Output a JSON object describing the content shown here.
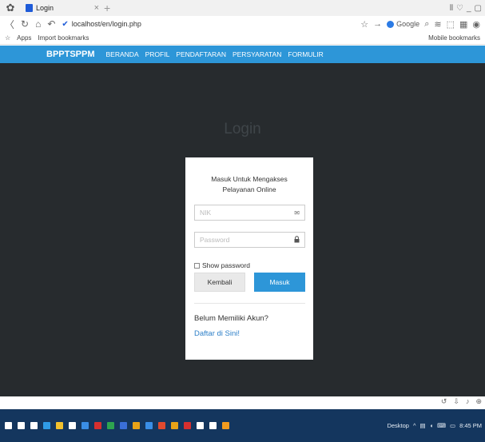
{
  "browser": {
    "tab_title": "Login",
    "tab_close": "×",
    "new_tab": "+",
    "window_controls": [
      "⫴",
      "♡",
      "_",
      "▢"
    ],
    "url": "localhost/en/login.php",
    "search_engine": "Google",
    "bookmarks": {
      "apps": "Apps",
      "import": "Import bookmarks",
      "mobile": "Mobile bookmarks"
    }
  },
  "site": {
    "brand": "BPPTSPPM",
    "nav": [
      "BERANDA",
      "PROFIL",
      "PENDAFTARAN",
      "PERSYARATAN",
      "FORMULIR"
    ],
    "page_title": "Login",
    "login": {
      "heading": "Masuk Untuk Mengakses Pelayanan Online",
      "nik_placeholder": "NIK",
      "password_placeholder": "Password",
      "show_password": "Show password",
      "back_button": "Kembali",
      "login_button": "Masuk",
      "no_account": "Belum Memiliki Akun?",
      "register_link": "Daftar di Sini!"
    }
  },
  "taskbar": {
    "desktop_label": "Desktop",
    "clock": "8:45 PM",
    "icon_colors": [
      "#ffffff",
      "#ffffff",
      "#ffffff",
      "#2f9be6",
      "#f2c12e",
      "#ffffff",
      "#3a8ee6",
      "#d62f2f",
      "#2ea44f",
      "#3a6fd8",
      "#e8a317",
      "#3a8ee6",
      "#e04a2f",
      "#e8a317",
      "#d62f2f",
      "#ffffff",
      "#ffffff",
      "#f29c1f"
    ]
  }
}
